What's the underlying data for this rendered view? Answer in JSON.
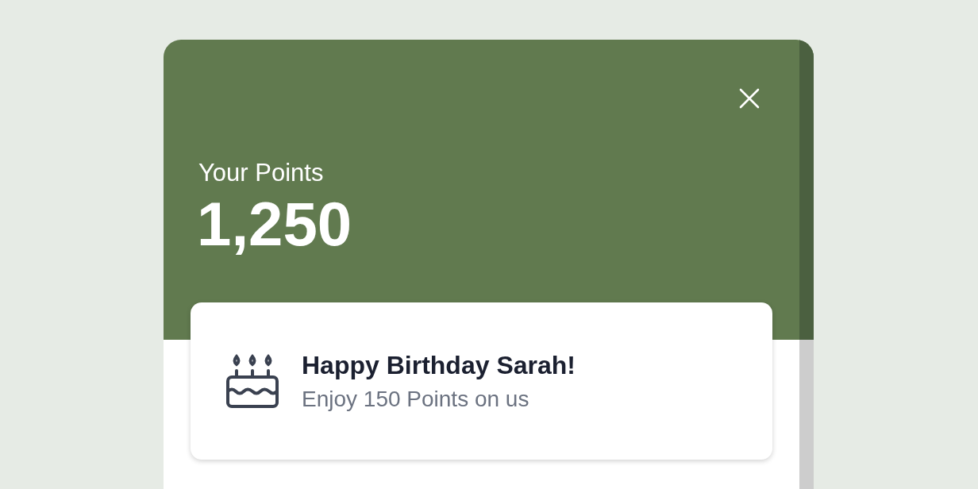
{
  "header": {
    "label": "Your Points",
    "points": "1,250"
  },
  "card": {
    "title": "Happy Birthday Sarah!",
    "subtitle": "Enjoy 150 Points on us"
  }
}
